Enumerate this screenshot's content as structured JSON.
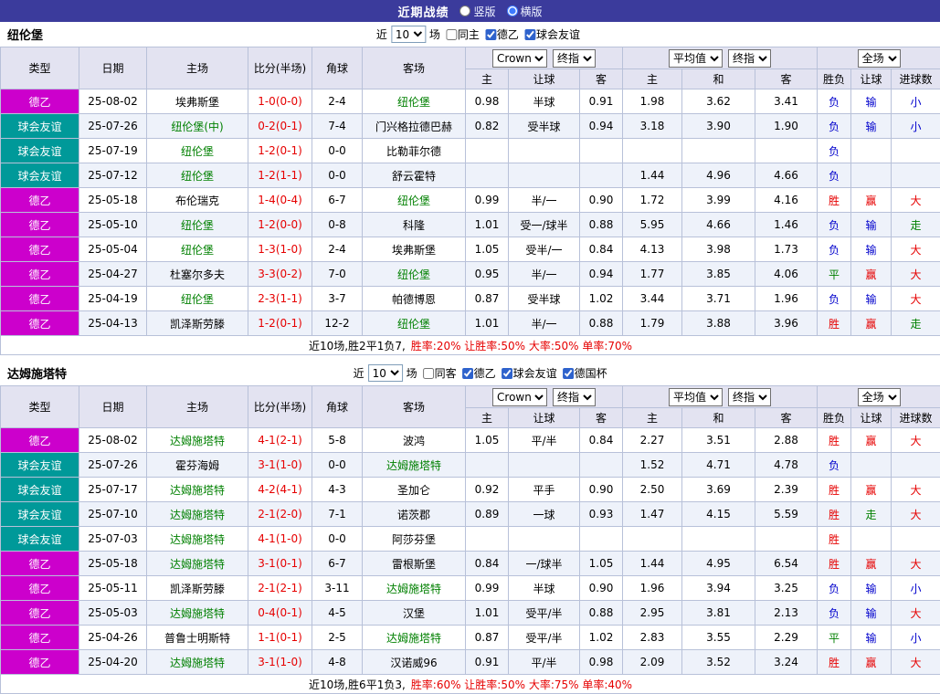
{
  "page": {
    "title": "近期战绩",
    "layout_options": [
      {
        "label": "竖版",
        "selected": false
      },
      {
        "label": "横版",
        "selected": true
      }
    ]
  },
  "table": {
    "columns": [
      "类型",
      "日期",
      "主场",
      "比分(半场)",
      "角球",
      "客场",
      "主",
      "让球",
      "客",
      "主",
      "和",
      "客",
      "胜负",
      "让球",
      "进球数"
    ],
    "dropdowns": {
      "company": "Crown",
      "company_final": "终指",
      "average": "平均值",
      "average_final": "终指",
      "fullmatch": "全场"
    }
  },
  "colors": {
    "league_deyi": "#cc00cc",
    "league_friendly": "#009999",
    "win_red": "#e60000",
    "lose_blue": "#0000cc",
    "draw_green": "#008000",
    "focus_team_green": "#008000",
    "score_red": "#e60000"
  },
  "sections": [
    {
      "team": "纽伦堡",
      "filter": {
        "near": "近",
        "count": "10",
        "unit": "场",
        "checks": [
          {
            "label": "同主",
            "checked": false
          },
          {
            "label": "德乙",
            "checked": true
          },
          {
            "label": "球会友谊",
            "checked": true
          }
        ]
      },
      "rows": [
        {
          "league": "德乙",
          "date": "25-08-02",
          "home": "埃弗斯堡",
          "home_focus": false,
          "score": "1-0(0-0)",
          "corner": "2-4",
          "away": "纽伦堡",
          "away_focus": true,
          "ah": [
            "0.98",
            "半球",
            "0.91"
          ],
          "eu": [
            "1.98",
            "3.62",
            "3.41"
          ],
          "results": [
            "负",
            "输",
            "小"
          ]
        },
        {
          "league": "球会友谊",
          "date": "25-07-26",
          "home": "纽伦堡(中)",
          "home_focus": true,
          "score": "0-2(0-1)",
          "corner": "7-4",
          "away": "门兴格拉德巴赫",
          "away_focus": false,
          "ah": [
            "0.82",
            "受半球",
            "0.94"
          ],
          "eu": [
            "3.18",
            "3.90",
            "1.90"
          ],
          "results": [
            "负",
            "输",
            "小"
          ]
        },
        {
          "league": "球会友谊",
          "date": "25-07-19",
          "home": "纽伦堡",
          "home_focus": true,
          "score": "1-2(0-1)",
          "corner": "0-0",
          "away": "比勒菲尔德",
          "away_focus": false,
          "ah": [
            "",
            "",
            ""
          ],
          "eu": [
            "",
            "",
            ""
          ],
          "results": [
            "负",
            "",
            ""
          ]
        },
        {
          "league": "球会友谊",
          "date": "25-07-12",
          "home": "纽伦堡",
          "home_focus": true,
          "score": "1-2(1-1)",
          "corner": "0-0",
          "away": "舒云霍特",
          "away_focus": false,
          "ah": [
            "",
            "",
            ""
          ],
          "eu": [
            "1.44",
            "4.96",
            "4.66"
          ],
          "results": [
            "负",
            "",
            ""
          ]
        },
        {
          "league": "德乙",
          "date": "25-05-18",
          "home": "布伦瑞克",
          "home_focus": false,
          "score": "1-4(0-4)",
          "corner": "6-7",
          "away": "纽伦堡",
          "away_focus": true,
          "ah": [
            "0.99",
            "半/一",
            "0.90"
          ],
          "eu": [
            "1.72",
            "3.99",
            "4.16"
          ],
          "results": [
            "胜",
            "赢",
            "大"
          ]
        },
        {
          "league": "德乙",
          "date": "25-05-10",
          "home": "纽伦堡",
          "home_focus": true,
          "score": "1-2(0-0)",
          "corner": "0-8",
          "away": "科隆",
          "away_focus": false,
          "ah": [
            "1.01",
            "受一/球半",
            "0.88"
          ],
          "eu": [
            "5.95",
            "4.66",
            "1.46"
          ],
          "results": [
            "负",
            "输",
            "走"
          ]
        },
        {
          "league": "德乙",
          "date": "25-05-04",
          "home": "纽伦堡",
          "home_focus": true,
          "score": "1-3(1-0)",
          "corner": "2-4",
          "away": "埃弗斯堡",
          "away_focus": false,
          "ah": [
            "1.05",
            "受半/一",
            "0.84"
          ],
          "eu": [
            "4.13",
            "3.98",
            "1.73"
          ],
          "results": [
            "负",
            "输",
            "大"
          ]
        },
        {
          "league": "德乙",
          "date": "25-04-27",
          "home": "杜塞尔多夫",
          "home_focus": false,
          "score": "3-3(0-2)",
          "corner": "7-0",
          "away": "纽伦堡",
          "away_focus": true,
          "ah": [
            "0.95",
            "半/一",
            "0.94"
          ],
          "eu": [
            "1.77",
            "3.85",
            "4.06"
          ],
          "results": [
            "平",
            "赢",
            "大"
          ]
        },
        {
          "league": "德乙",
          "date": "25-04-19",
          "home": "纽伦堡",
          "home_focus": true,
          "score": "2-3(1-1)",
          "corner": "3-7",
          "away": "帕德博恩",
          "away_focus": false,
          "ah": [
            "0.87",
            "受半球",
            "1.02"
          ],
          "eu": [
            "3.44",
            "3.71",
            "1.96"
          ],
          "results": [
            "负",
            "输",
            "大"
          ]
        },
        {
          "league": "德乙",
          "date": "25-04-13",
          "home": "凯泽斯劳滕",
          "home_focus": false,
          "score": "1-2(0-1)",
          "corner": "12-2",
          "away": "纽伦堡",
          "away_focus": true,
          "ah": [
            "1.01",
            "半/一",
            "0.88"
          ],
          "eu": [
            "1.79",
            "3.88",
            "3.96"
          ],
          "results": [
            "胜",
            "赢",
            "走"
          ]
        }
      ],
      "summary": {
        "record": "近10场,胜2平1负7,",
        "rates": "胜率:20% 让胜率:50% 大率:50% 单率:70%"
      }
    },
    {
      "team": "达姆施塔特",
      "filter": {
        "near": "近",
        "count": "10",
        "unit": "场",
        "checks": [
          {
            "label": "同客",
            "checked": false
          },
          {
            "label": "德乙",
            "checked": true
          },
          {
            "label": "球会友谊",
            "checked": true
          },
          {
            "label": "德国杯",
            "checked": true
          }
        ]
      },
      "rows": [
        {
          "league": "德乙",
          "date": "25-08-02",
          "home": "达姆施塔特",
          "home_focus": true,
          "score": "4-1(2-1)",
          "corner": "5-8",
          "away": "波鸿",
          "away_focus": false,
          "ah": [
            "1.05",
            "平/半",
            "0.84"
          ],
          "eu": [
            "2.27",
            "3.51",
            "2.88"
          ],
          "results": [
            "胜",
            "赢",
            "大"
          ]
        },
        {
          "league": "球会友谊",
          "date": "25-07-26",
          "home": "霍芬海姆",
          "home_focus": false,
          "score": "3-1(1-0)",
          "corner": "0-0",
          "away": "达姆施塔特",
          "away_focus": true,
          "ah": [
            "",
            "",
            ""
          ],
          "eu": [
            "1.52",
            "4.71",
            "4.78"
          ],
          "results": [
            "负",
            "",
            ""
          ]
        },
        {
          "league": "球会友谊",
          "date": "25-07-17",
          "home": "达姆施塔特",
          "home_focus": true,
          "score": "4-2(4-1)",
          "corner": "4-3",
          "away": "圣加仑",
          "away_focus": false,
          "ah": [
            "0.92",
            "平手",
            "0.90"
          ],
          "eu": [
            "2.50",
            "3.69",
            "2.39"
          ],
          "results": [
            "胜",
            "赢",
            "大"
          ]
        },
        {
          "league": "球会友谊",
          "date": "25-07-10",
          "home": "达姆施塔特",
          "home_focus": true,
          "score": "2-1(2-0)",
          "corner": "7-1",
          "away": "诺茨郡",
          "away_focus": false,
          "ah": [
            "0.89",
            "一球",
            "0.93"
          ],
          "eu": [
            "1.47",
            "4.15",
            "5.59"
          ],
          "results": [
            "胜",
            "走",
            "大"
          ]
        },
        {
          "league": "球会友谊",
          "date": "25-07-03",
          "home": "达姆施塔特",
          "home_focus": true,
          "score": "4-1(1-0)",
          "corner": "0-0",
          "away": "阿莎芬堡",
          "away_focus": false,
          "ah": [
            "",
            "",
            ""
          ],
          "eu": [
            "",
            "",
            ""
          ],
          "results": [
            "胜",
            "",
            ""
          ]
        },
        {
          "league": "德乙",
          "date": "25-05-18",
          "home": "达姆施塔特",
          "home_focus": true,
          "score": "3-1(0-1)",
          "corner": "6-7",
          "away": "雷根斯堡",
          "away_focus": false,
          "ah": [
            "0.84",
            "一/球半",
            "1.05"
          ],
          "eu": [
            "1.44",
            "4.95",
            "6.54"
          ],
          "results": [
            "胜",
            "赢",
            "大"
          ]
        },
        {
          "league": "德乙",
          "date": "25-05-11",
          "home": "凯泽斯劳滕",
          "home_focus": false,
          "score": "2-1(2-1)",
          "corner": "3-11",
          "away": "达姆施塔特",
          "away_focus": true,
          "ah": [
            "0.99",
            "半球",
            "0.90"
          ],
          "eu": [
            "1.96",
            "3.94",
            "3.25"
          ],
          "results": [
            "负",
            "输",
            "小"
          ]
        },
        {
          "league": "德乙",
          "date": "25-05-03",
          "home": "达姆施塔特",
          "home_focus": true,
          "score": "0-4(0-1)",
          "corner": "4-5",
          "away": "汉堡",
          "away_focus": false,
          "ah": [
            "1.01",
            "受平/半",
            "0.88"
          ],
          "eu": [
            "2.95",
            "3.81",
            "2.13"
          ],
          "results": [
            "负",
            "输",
            "大"
          ]
        },
        {
          "league": "德乙",
          "date": "25-04-26",
          "home": "普鲁士明斯特",
          "home_focus": false,
          "score": "1-1(0-1)",
          "corner": "2-5",
          "away": "达姆施塔特",
          "away_focus": true,
          "ah": [
            "0.87",
            "受平/半",
            "1.02"
          ],
          "eu": [
            "2.83",
            "3.55",
            "2.29"
          ],
          "results": [
            "平",
            "输",
            "小"
          ]
        },
        {
          "league": "德乙",
          "date": "25-04-20",
          "home": "达姆施塔特",
          "home_focus": true,
          "score": "3-1(1-0)",
          "corner": "4-8",
          "away": "汉诺威96",
          "away_focus": false,
          "ah": [
            "0.91",
            "平/半",
            "0.98"
          ],
          "eu": [
            "2.09",
            "3.52",
            "3.24"
          ],
          "results": [
            "胜",
            "赢",
            "大"
          ]
        }
      ],
      "summary": {
        "record": "近10场,胜6平1负3,",
        "rates": "胜率:60% 让胜率:50% 大率:75% 单率:40%"
      }
    }
  ]
}
